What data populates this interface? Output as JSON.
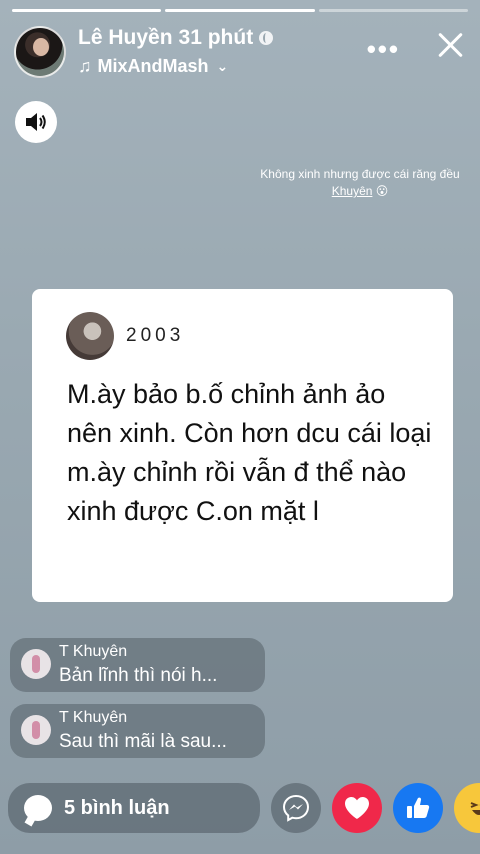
{
  "story": {
    "progress_segments": [
      1,
      1,
      0
    ]
  },
  "header": {
    "author": "Lê Huyền",
    "time": "31 phút",
    "music": "MixAndMash"
  },
  "caption": {
    "text": "Không xinh nhưng được cái răng đều",
    "tag": "Khuyên",
    "emoji": "😮"
  },
  "card": {
    "username": "2003",
    "text": "M.ày bảo b.ố chỉnh ảnh ảo nên xinh. Còn hơn dcu cái loại m.ày chỉnh rồi vẫn đ thể nào xinh được C.on mặt l"
  },
  "comments": [
    {
      "name": "T Khuyên",
      "text": "Bản lĩnh thì nói h..."
    },
    {
      "name": "T Khuyên",
      "text": "Sau thì mãi là sau..."
    }
  ],
  "footer": {
    "comment_count_label": "5 bình luận"
  },
  "icons": {
    "sound": "speaker-icon",
    "more": "more-horizontal-icon",
    "close": "close-icon",
    "messenger": "messenger-icon",
    "heart": "heart-icon",
    "like": "thumbs-up-icon",
    "haha": "haha-icon"
  },
  "colors": {
    "heart": "#f0284a",
    "like": "#1778f2",
    "haha": "#f7c73b"
  }
}
